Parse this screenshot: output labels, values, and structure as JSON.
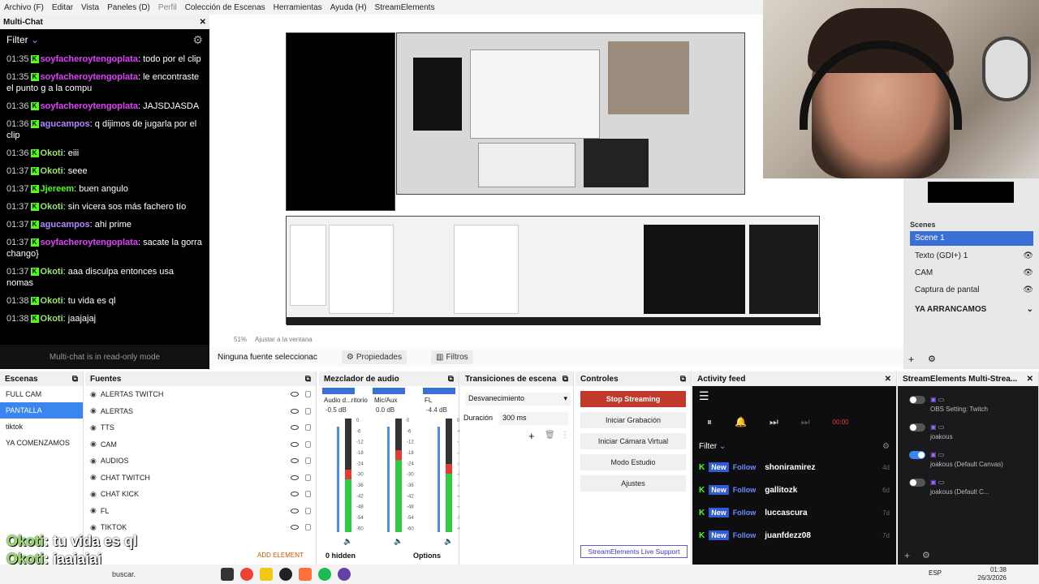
{
  "menubar": {
    "items": [
      "Archivo (F)",
      "Editar",
      "Vista",
      "Paneles (D)",
      "Perfil",
      "Colección de Escenas",
      "Herramientas",
      "Ayuda (H)",
      "StreamElements"
    ]
  },
  "multichat": {
    "title": "Multi-Chat",
    "filter_label": "Filter",
    "readonly_text": "Multi-chat is in read-only mode",
    "messages": [
      {
        "time": "01:35",
        "user": "soyfacheroytengoplata",
        "text": "todo por el clip",
        "color": "#e040fb"
      },
      {
        "time": "01:35",
        "user": "soyfacheroytengoplata",
        "text": "le encontraste el punto g a la compu",
        "color": "#e040fb"
      },
      {
        "time": "01:36",
        "user": "soyfacheroytengoplata",
        "text": "JAJSDJASDA",
        "color": "#e040fb"
      },
      {
        "time": "01:36",
        "user": "agucampos",
        "text": "q dijimos de jugarla por el clip",
        "color": "#b388ff"
      },
      {
        "time": "01:36",
        "user": "Okoti",
        "text": "eiii",
        "color": "#9be36b"
      },
      {
        "time": "01:37",
        "user": "Okoti",
        "text": "seee",
        "color": "#9be36b"
      },
      {
        "time": "01:37",
        "user": "Jjereem",
        "text": "buen angulo",
        "color": "#53fc18"
      },
      {
        "time": "01:37",
        "user": "Okoti",
        "text": "sin vicera sos más fachero tío",
        "color": "#9be36b"
      },
      {
        "time": "01:37",
        "user": "agucampos",
        "text": "ahi prime",
        "color": "#b388ff"
      },
      {
        "time": "01:37",
        "user": "soyfacheroytengoplata",
        "text": "sacate la gorra chango}",
        "color": "#e040fb"
      },
      {
        "time": "01:37",
        "user": "Okoti",
        "text": "aaa disculpa entonces usa nomas",
        "color": "#9be36b"
      },
      {
        "time": "01:38",
        "user": "Okoti",
        "text": "tu vida es ql",
        "color": "#9be36b"
      },
      {
        "time": "01:38",
        "user": "Okoti",
        "text": "jaajajaj",
        "color": "#9be36b"
      }
    ]
  },
  "preview": {
    "zoom": "51%",
    "fit_label": "Ajustar a la ventana",
    "no_source": "Ninguna fuente seleccionac",
    "properties": "Propiedades",
    "filters": "Filtros"
  },
  "scene_panel": {
    "header": "Scenes",
    "selected": "Scene 1",
    "items": [
      "Texto (GDI+) 1",
      "CAM",
      "Captura de pantal"
    ],
    "group": "YA ARRANCAMOS"
  },
  "scenes": {
    "title": "Escenas",
    "items": [
      "FULL CAM",
      "PANTALLA",
      "tiktok",
      "YA COMENZAMOS"
    ],
    "selected_index": 1
  },
  "sources": {
    "title": "Fuentes",
    "items": [
      "ALERTAS TWITCH",
      "ALERTAS",
      "TTS",
      "CAM",
      "AUDIOS",
      "CHAT TWITCH",
      "CHAT KICK",
      "FL",
      "TIKTOK"
    ],
    "add_element": "ADD ELEMENT"
  },
  "mixer": {
    "title": "Mezclador de audio",
    "channels": [
      {
        "name": "Audio d...ritorio",
        "db": "-0.5 dB",
        "level": 0.55
      },
      {
        "name": "Mic/Aux",
        "db": "0.0 dB",
        "level": 0.72
      },
      {
        "name": "FL",
        "db": "-4.4 dB",
        "level": 0.6
      }
    ],
    "scale": [
      "0",
      "-6",
      "-12",
      "-18",
      "-24",
      "-30",
      "-36",
      "-42",
      "-48",
      "-54",
      "-60"
    ],
    "hidden": "0 hidden",
    "options": "Options"
  },
  "transitions": {
    "title": "Transiciones de escena",
    "type": "Desvanecimiento",
    "duration_label": "Duración",
    "duration": "300 ms"
  },
  "controls": {
    "title": "Controles",
    "stop": "Stop Streaming",
    "record": "Iniciar Grabación",
    "vcam": "Iniciar Cámara Virtual",
    "studio": "Modo Estudio",
    "settings": "Ajustes",
    "support": "StreamElements Live Support"
  },
  "activity": {
    "title": "Activity feed",
    "filter": "Filter",
    "rows": [
      {
        "user": "shoniramirez",
        "age": "4d"
      },
      {
        "user": "gallitozk",
        "age": "6d"
      },
      {
        "user": "luccascura",
        "age": "7d"
      },
      {
        "user": "juanfdezz08",
        "age": "7d"
      }
    ],
    "tag_new": "New",
    "tag_follow": "Follow"
  },
  "se_multistream": {
    "title": "StreamElements Multi-Strea...",
    "rows": [
      {
        "label": "OBS Setting: Twitch",
        "on": false
      },
      {
        "label": "joakous",
        "on": false
      },
      {
        "label": "joakous (Default Canvas)",
        "on": true
      },
      {
        "label": "joakous (Default C...",
        "on": false
      }
    ]
  },
  "taskbar": {
    "search": "buscar.",
    "time": "01:38",
    "date": "26/3/2026",
    "lang": "ESP"
  },
  "overlay": {
    "lines": [
      {
        "name": "Okoti",
        "text": ": tu vida es ql"
      },
      {
        "name": "Okoti",
        "text": ": jaajajaj"
      }
    ]
  },
  "colors": {
    "accent": "#3a86f0",
    "stop": "#c0392b",
    "kick": "#53fc18"
  }
}
